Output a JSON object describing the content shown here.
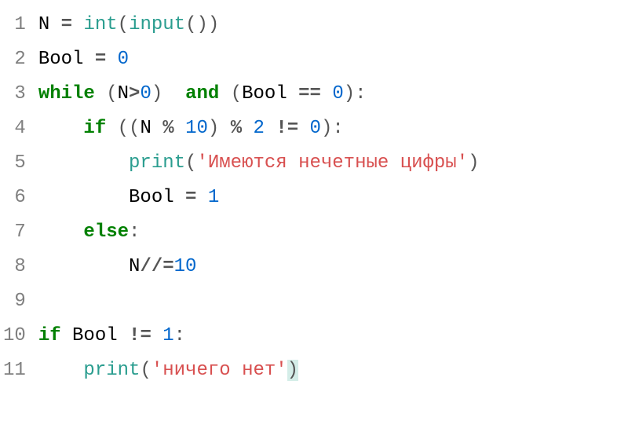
{
  "lines": [
    {
      "num": "1",
      "indent": "",
      "tokens": [
        {
          "t": "N ",
          "c": "tok-id"
        },
        {
          "t": "=",
          "c": "tok-op"
        },
        {
          "t": " ",
          "c": "tok-id"
        },
        {
          "t": "int",
          "c": "tok-fn"
        },
        {
          "t": "(",
          "c": "tok-paren"
        },
        {
          "t": "input",
          "c": "tok-fn"
        },
        {
          "t": "()",
          "c": "tok-paren"
        },
        {
          "t": ")",
          "c": "tok-paren"
        }
      ]
    },
    {
      "num": "2",
      "indent": "",
      "tokens": [
        {
          "t": "Bool ",
          "c": "tok-id"
        },
        {
          "t": "=",
          "c": "tok-op"
        },
        {
          "t": " ",
          "c": "tok-id"
        },
        {
          "t": "0",
          "c": "tok-num"
        }
      ]
    },
    {
      "num": "3",
      "indent": "",
      "tokens": [
        {
          "t": "while",
          "c": "tok-kw"
        },
        {
          "t": " ",
          "c": "tok-id"
        },
        {
          "t": "(",
          "c": "tok-paren"
        },
        {
          "t": "N",
          "c": "tok-id"
        },
        {
          "t": ">",
          "c": "tok-op"
        },
        {
          "t": "0",
          "c": "tok-num"
        },
        {
          "t": ")",
          "c": "tok-paren"
        },
        {
          "t": "  ",
          "c": "tok-id"
        },
        {
          "t": "and",
          "c": "tok-kw"
        },
        {
          "t": " ",
          "c": "tok-id"
        },
        {
          "t": "(",
          "c": "tok-paren"
        },
        {
          "t": "Bool ",
          "c": "tok-id"
        },
        {
          "t": "==",
          "c": "tok-op"
        },
        {
          "t": " ",
          "c": "tok-id"
        },
        {
          "t": "0",
          "c": "tok-num"
        },
        {
          "t": ")",
          "c": "tok-paren"
        },
        {
          "t": ":",
          "c": "tok-paren"
        }
      ]
    },
    {
      "num": "4",
      "indent": "    ",
      "tokens": [
        {
          "t": "if",
          "c": "tok-kw"
        },
        {
          "t": " ",
          "c": "tok-id"
        },
        {
          "t": "((",
          "c": "tok-paren"
        },
        {
          "t": "N ",
          "c": "tok-id"
        },
        {
          "t": "%",
          "c": "tok-op"
        },
        {
          "t": " ",
          "c": "tok-id"
        },
        {
          "t": "10",
          "c": "tok-num"
        },
        {
          "t": ")",
          "c": "tok-paren"
        },
        {
          "t": " ",
          "c": "tok-id"
        },
        {
          "t": "%",
          "c": "tok-op"
        },
        {
          "t": " ",
          "c": "tok-id"
        },
        {
          "t": "2",
          "c": "tok-num"
        },
        {
          "t": " ",
          "c": "tok-id"
        },
        {
          "t": "!=",
          "c": "tok-op"
        },
        {
          "t": " ",
          "c": "tok-id"
        },
        {
          "t": "0",
          "c": "tok-num"
        },
        {
          "t": ")",
          "c": "tok-paren"
        },
        {
          "t": ":",
          "c": "tok-paren"
        }
      ]
    },
    {
      "num": "5",
      "indent": "        ",
      "tokens": [
        {
          "t": "print",
          "c": "tok-fn"
        },
        {
          "t": "(",
          "c": "tok-paren"
        },
        {
          "t": "'Имеются нечетные цифры'",
          "c": "tok-str"
        },
        {
          "t": ")",
          "c": "tok-paren"
        }
      ]
    },
    {
      "num": "6",
      "indent": "        ",
      "tokens": [
        {
          "t": "Bool ",
          "c": "tok-id"
        },
        {
          "t": "=",
          "c": "tok-op"
        },
        {
          "t": " ",
          "c": "tok-id"
        },
        {
          "t": "1",
          "c": "tok-num"
        }
      ]
    },
    {
      "num": "7",
      "indent": "    ",
      "tokens": [
        {
          "t": "else",
          "c": "tok-kw"
        },
        {
          "t": ":",
          "c": "tok-paren"
        }
      ]
    },
    {
      "num": "8",
      "indent": "        ",
      "tokens": [
        {
          "t": "N",
          "c": "tok-id"
        },
        {
          "t": "//=",
          "c": "tok-op"
        },
        {
          "t": "10",
          "c": "tok-num"
        }
      ]
    },
    {
      "num": "9",
      "indent": "",
      "tokens": []
    },
    {
      "num": "10",
      "indent": "",
      "tokens": [
        {
          "t": "if",
          "c": "tok-kw"
        },
        {
          "t": " Bool ",
          "c": "tok-id"
        },
        {
          "t": "!=",
          "c": "tok-op"
        },
        {
          "t": " ",
          "c": "tok-id"
        },
        {
          "t": "1",
          "c": "tok-num"
        },
        {
          "t": ":",
          "c": "tok-paren"
        }
      ]
    },
    {
      "num": "11",
      "indent": "    ",
      "tokens": [
        {
          "t": "print",
          "c": "tok-fn"
        },
        {
          "t": "(",
          "c": "tok-paren"
        },
        {
          "t": "'ничего нет'",
          "c": "tok-str"
        },
        {
          "t": ")",
          "c": "tok-paren cursor-bg"
        }
      ]
    }
  ]
}
